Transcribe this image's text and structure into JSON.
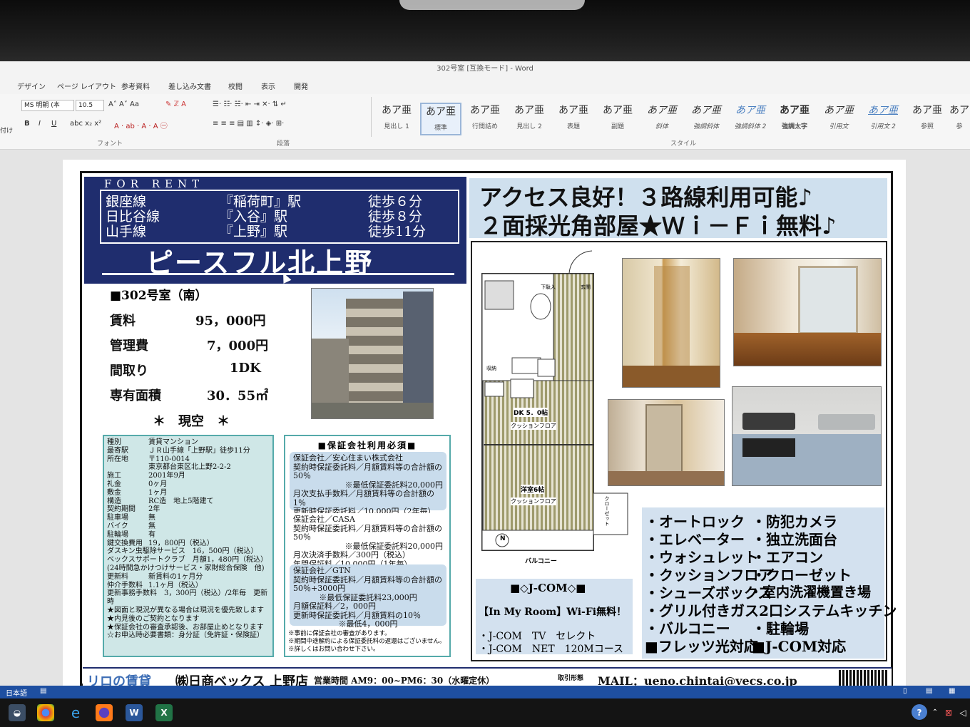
{
  "window": {
    "title": "302号室 [互換モード] - Word"
  },
  "ribbon": {
    "tabs": [
      "デザイン",
      "ページ レイアウト",
      "参考資料",
      "差し込み文書",
      "校閲",
      "表示",
      "開発"
    ],
    "font_name": "MS 明朝 (本",
    "font_size": "10.5",
    "group_font": "フォント",
    "group_para": "段落",
    "group_style": "スタイル",
    "left_label": "付け",
    "styles": [
      {
        "sample": "あア亜",
        "label": "見出し 1"
      },
      {
        "sample": "あア亜",
        "label": "標準"
      },
      {
        "sample": "あア亜",
        "label": "行間詰め"
      },
      {
        "sample": "あア亜",
        "label": "見出し 2"
      },
      {
        "sample": "あア亜",
        "label": "表題"
      },
      {
        "sample": "あア亜",
        "label": "副題"
      },
      {
        "sample": "あア亜",
        "label": "斜体"
      },
      {
        "sample": "あア亜",
        "label": "強調斜体"
      },
      {
        "sample": "あア亜",
        "label": "強調斜体 2"
      },
      {
        "sample": "あア亜",
        "label": "強調太字"
      },
      {
        "sample": "あア亜",
        "label": "引用文"
      },
      {
        "sample": "あア亜",
        "label": "引用文 2"
      },
      {
        "sample": "あア亜",
        "label": "参照"
      },
      {
        "sample": "あア",
        "label": "参"
      }
    ]
  },
  "flyer": {
    "for_rent": "FOR RENT",
    "lines": [
      {
        "line": "銀座線",
        "station": "『稲荷町』駅",
        "walk": "徒歩６分"
      },
      {
        "line": "日比谷線",
        "station": "『入谷』駅",
        "walk": "徒歩８分"
      },
      {
        "line": "山手線",
        "station": "『上野』駅",
        "walk": "徒歩11分"
      }
    ],
    "building": "ピースフル北上野",
    "room": "■302号室（南）",
    "rent_label": "賃料",
    "rent": "95，000円",
    "mgmt_label": "管理費",
    "mgmt": "7，000円",
    "layout_label": "間取り",
    "layout": "1DK",
    "area_label": "専有面積",
    "area": "30．55㎡",
    "status": "＊　現空　＊",
    "details": [
      {
        "k": "種別",
        "v": "賃貸マンション"
      },
      {
        "k": "最寄駅",
        "v": "ＪＲ山手線「上野駅」徒歩11分"
      },
      {
        "k": "所在地",
        "v": "〒110-0014"
      },
      {
        "k": "",
        "v": "東京都台東区北上野2-2-2"
      },
      {
        "k": "施工",
        "v": "2001年9月"
      },
      {
        "k": "礼金",
        "v": "0ヶ月"
      },
      {
        "k": "敷金",
        "v": "1ヶ月"
      },
      {
        "k": "構造",
        "v": "RC造　地上5階建て"
      },
      {
        "k": "契約期間",
        "v": "2年"
      },
      {
        "k": "駐車場",
        "v": "無"
      },
      {
        "k": "バイク",
        "v": "無"
      },
      {
        "k": "駐輪場",
        "v": "有"
      },
      {
        "k": "鍵交換費用",
        "v": "19，800円（税込）"
      },
      {
        "k": "",
        "v": "ダスキン虫駆除サービス　16，500円（税込）"
      },
      {
        "k": "",
        "v": "ベックスサポートクラブ　月額1，480円（税込）"
      },
      {
        "k": "",
        "v": "(24時間急かけつけサービス・家財総合保険　他)"
      },
      {
        "k": "更新料",
        "v": "新賃料の1ヶ月分"
      },
      {
        "k": "仲介手数料",
        "v": "1.1ヶ月（税込）"
      },
      {
        "k": "",
        "v": "更新事務手数料　3，300円（税込）/2年毎　更新時"
      },
      {
        "k": "",
        "v": "★図面と現況が異なる場合は現況を優先致します"
      },
      {
        "k": "",
        "v": "★内見後のご契約となります"
      },
      {
        "k": "",
        "v": "★保証会社の審査承認後、お部屋止めとなります"
      },
      {
        "k": "",
        "v": "☆お申込時必要書類：身分証（免許証・保険証）"
      }
    ],
    "guarantee_title": "■保証会社利用必須■",
    "guarantee_blocks": [
      [
        "保証会社／安心住まい株式会社",
        "契約時保証委託料／月額賃料等の合計額の50％",
        "※最低保証委託料20,000円",
        "月次支払手数料／月額賃料等の合計額の1％",
        "更新時保証委託料／10,000円（2年毎）"
      ],
      [
        "保証会社／CASA",
        "契約時保証委託料／月額賃料等の合計額の50％",
        "※最低保証委託料20,000円",
        "月次決済手数料／300円（税込）",
        "年間保証料／10,000円（1年毎）"
      ],
      [
        "保証会社／GTN",
        "契約時保証委託料／月額賃料等の合計額の50％+3000円",
        "※最低保証委託料23,000円",
        "月額保証料／2，000円",
        "更新時保証委託料／月額賃料の10％",
        "※最低4，000円"
      ]
    ],
    "guarantee_note1": "※事前に保証会社の審査があります。",
    "guarantee_note2": "※期間中途解約による保証委託料の返還はございません。",
    "guarantee_note3": "※詳しくはお問い合わせ下さい。",
    "headline1": "アクセス良好！３路線利用可能♪",
    "headline2": "２面採光角部屋★Ｗｉ－Ｆｉ無料♪",
    "floor": {
      "entrance": "玄関",
      "shoes": "下駄入",
      "storage": "収納",
      "dk": "DK 5．0帖",
      "dk_floor": "クッションフロア",
      "room": "洋室6帖",
      "room_floor": "クッションフロア",
      "closet": "クローゼット",
      "balcony": "バルコニー",
      "north": "N"
    },
    "jcom_title": "■◇J-COM◇■",
    "jcom_wifi": "【In My Room】Wi-Fi無料！",
    "jcom_tv": "・J-COM　TV　セレクト",
    "jcom_net": "・J-COM　NET　120Mコース",
    "features": [
      "・オートロック",
      "・防犯カメラ",
      "・エレベーター",
      "・独立洗面台",
      "・ウォシュレット",
      "・エアコン",
      "・クッションフロア",
      "・クローゼット",
      "・シューズボックス",
      "・室内洗濯機置き場",
      "・グリル付きガス2口システムキッチン",
      "",
      "・バルコニー",
      "・駐輪場",
      "■フレッツ光対応",
      "■J-COM対応"
    ],
    "footer_left": "リロの賃貸",
    "footer_company": "㈱日商ベックス",
    "footer_branch": "上野店",
    "footer_hours": "営業時間 AM9：00~PM6：30（水曜定休）",
    "footer_mail": "MAIL：ueno.chintai@vecs.co.jp",
    "footer_deal": "取引形態"
  },
  "statusbar": {
    "lang": "日本語"
  },
  "colors": {
    "navy": "#1f2d6e",
    "light_blue": "#cfe0ee",
    "teal_box": "#cfe7e7",
    "word_blue": "#1e4fa1"
  }
}
